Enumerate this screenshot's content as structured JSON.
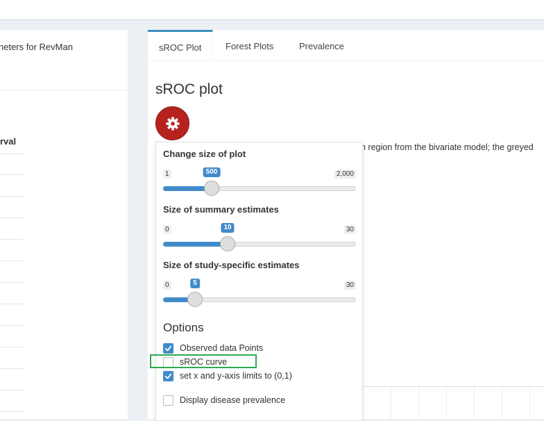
{
  "left_panel": {
    "title": "neters for RevMan",
    "column_heading": "rval"
  },
  "tabs": [
    {
      "label": "sROC Plot",
      "active": true
    },
    {
      "label": "Forest Plots",
      "active": false
    },
    {
      "label": "Prevalence",
      "active": false
    }
  ],
  "main": {
    "title": "sROC plot",
    "settings_icon": "gear-icon",
    "description": "n region from the bivariate model; the greyed"
  },
  "dropdown": {
    "sliders": [
      {
        "label": "Change size of plot",
        "min": "1",
        "max": "2,000",
        "value": "500",
        "fraction": 0.25
      },
      {
        "label": "Size of summary estimates",
        "min": "0",
        "max": "30",
        "value": "10",
        "fraction": 0.333
      },
      {
        "label": "Size of study-specific estimates",
        "min": "0",
        "max": "30",
        "value": "5",
        "fraction": 0.167
      }
    ],
    "options_title": "Options",
    "options": [
      {
        "label": "Observed data Points",
        "checked": true
      },
      {
        "label": "sROC curve",
        "checked": false
      },
      {
        "label": "set x and y-axis limits to (0,1)",
        "checked": true
      },
      {
        "label": "Display disease prevalence",
        "checked": false
      }
    ]
  },
  "colors": {
    "accent": "#428bca",
    "settings_button": "#b6231f",
    "highlight": "#2fa84f"
  }
}
